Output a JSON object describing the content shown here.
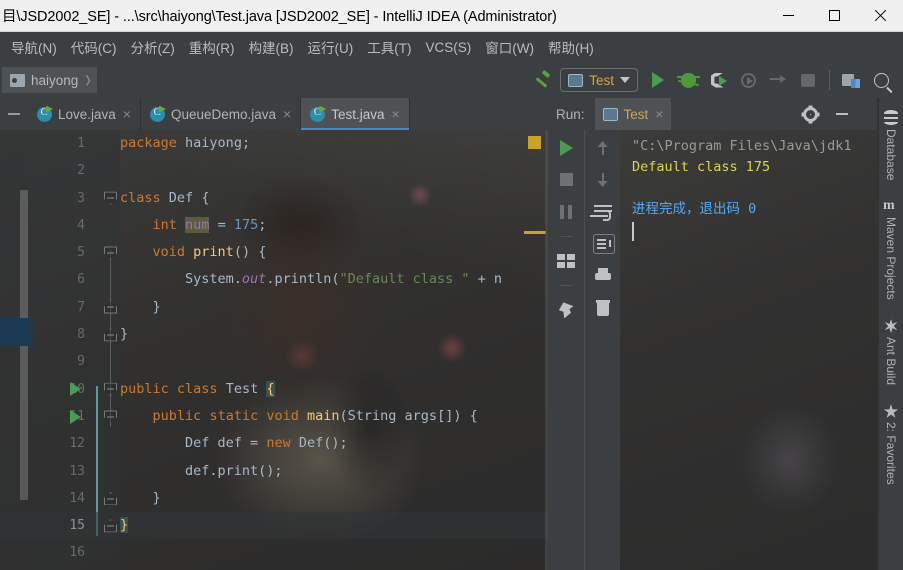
{
  "window": {
    "title": "目\\JSD2002_SE] - ...\\src\\haiyong\\Test.java [JSD2002_SE] - IntelliJ IDEA (Administrator)",
    "controls": {
      "minimize": "–",
      "maximize": "□",
      "close": "✕"
    }
  },
  "menubar": {
    "items": [
      {
        "label": "导航(N)"
      },
      {
        "label": "代码(C)"
      },
      {
        "label": "分析(Z)"
      },
      {
        "label": "重构(R)"
      },
      {
        "label": "构建(B)"
      },
      {
        "label": "运行(U)"
      },
      {
        "label": "工具(T)"
      },
      {
        "label": "VCS(S)"
      },
      {
        "label": "窗口(W)"
      },
      {
        "label": "帮助(H)"
      }
    ]
  },
  "toolbar": {
    "breadcrumb": "haiyong",
    "breadcrumb_separator": "›",
    "run_config": "Test",
    "icons": [
      "hammer-build-icon",
      "run-icon",
      "debug-icon",
      "run-with-coverage-icon",
      "profile-icon",
      "step-icon",
      "stop-icon",
      "project-structure-icon",
      "search-icon"
    ]
  },
  "editor": {
    "tabs": [
      {
        "label": "Love.java",
        "active": false,
        "close": "×"
      },
      {
        "label": "QueueDemo.java",
        "active": false,
        "close": "×"
      },
      {
        "label": "Test.java",
        "active": true,
        "close": "×"
      }
    ],
    "lines": [
      {
        "n": "1",
        "text": "package haiyong;"
      },
      {
        "n": "2",
        "text": ""
      },
      {
        "n": "3",
        "text": "class Def {"
      },
      {
        "n": "4",
        "text": "    int num = 175;"
      },
      {
        "n": "5",
        "text": "    void print() {"
      },
      {
        "n": "6",
        "text": "        System.out.println(\"Default class \" + n"
      },
      {
        "n": "7",
        "text": "    }"
      },
      {
        "n": "8",
        "text": "}"
      },
      {
        "n": "9",
        "text": ""
      },
      {
        "n": "10",
        "text": "public class Test {"
      },
      {
        "n": "11",
        "text": "    public static void main(String args[]) {"
      },
      {
        "n": "12",
        "text": "        Def def = new Def();"
      },
      {
        "n": "13",
        "text": "        def.print();"
      },
      {
        "n": "14",
        "text": "    }"
      },
      {
        "n": "15",
        "text": "}"
      },
      {
        "n": "16",
        "text": ""
      }
    ],
    "current_line": "15"
  },
  "run_panel": {
    "title": "Run:",
    "tab": "Test",
    "tab_close": "×",
    "console": {
      "line1": "\"C:\\Program Files\\Java\\jdk1",
      "line2": "Default class 175",
      "line3": "",
      "line4": "进程完成，退出码 0"
    },
    "left_tools": [
      "rerun-icon",
      "stop-icon",
      "pause-icon",
      "layout-icon",
      "pin-icon"
    ],
    "right_tools": [
      "arrow-up-icon",
      "arrow-down-icon",
      "soft-wrap-icon",
      "scroll-to-end-icon",
      "print-icon",
      "trash-icon"
    ],
    "header_tools": [
      "gear-icon",
      "minimize-icon"
    ]
  },
  "right_strip": {
    "items": [
      {
        "label": "Database",
        "icon": "database-icon"
      },
      {
        "label": "Maven Projects",
        "icon": "maven-icon"
      },
      {
        "label": "Ant Build",
        "icon": "ant-icon"
      },
      {
        "label": "2: Favorites",
        "icon": "star-icon"
      }
    ]
  },
  "colors": {
    "keyword": "#cc7832",
    "string": "#6a8759",
    "number": "#6897bb",
    "field": "#9876aa",
    "method": "#ffc66d",
    "accent": "#4a88c7",
    "console_yellow": "#d8d84a",
    "console_blue": "#56a8f5",
    "run_green": "#499c54"
  }
}
